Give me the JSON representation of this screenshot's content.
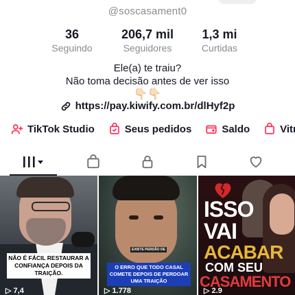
{
  "profile": {
    "handle": "@soscasament0",
    "stats": [
      {
        "value": "36",
        "label": "Seguindo"
      },
      {
        "value": "206,7 mil",
        "label": "Seguidores"
      },
      {
        "value": "1,3 mi",
        "label": "Curtidas"
      }
    ],
    "bio": {
      "line1": "Ele(a) te traiu?",
      "line2": "Não toma decisão antes de ver isso",
      "line3": "👇🏻👇🏻"
    },
    "link": "https://pay.kiwify.com.br/dlHyf2p"
  },
  "shortcuts": [
    {
      "label": "TikTok Studio",
      "icon": "person-plus-icon"
    },
    {
      "label": "Seus pedidos",
      "icon": "shopping-bag-check-icon"
    },
    {
      "label": "Saldo",
      "icon": "wallet-icon"
    },
    {
      "label": "Vitri",
      "icon": "shopping-bag-icon"
    }
  ],
  "tabs": [
    {
      "name": "videos",
      "icon": "grid-bars-icon",
      "active": true
    },
    {
      "name": "shop",
      "icon": "shopping-bag-icon"
    },
    {
      "name": "private",
      "icon": "lock-icon"
    },
    {
      "name": "saved",
      "icon": "bookmark-icon"
    },
    {
      "name": "liked",
      "icon": "heart-icon"
    }
  ],
  "videos": [
    {
      "caption": "NÃO É FÁCIL RESTAURAR A CONFIANÇA DEPOIS DA TRAIÇÃO.",
      "views": "▷ 7,4"
    },
    {
      "small_tag": "EXISTE PERDÃO DE",
      "caption": "O ERRO QUE TODO CASAL COMETE DEPOIS DE PERDOAR UMA TRAIÇÃO",
      "views": "▷ 1.778"
    },
    {
      "title_lines": [
        "ISSO",
        "VAI",
        "ACABAR",
        "COM SEU",
        "CASAMENTO"
      ],
      "views": "▷ 2.9"
    }
  ],
  "colors": {
    "text": "#161823",
    "muted": "#8a8b91",
    "accent": "#fe2c55",
    "cell3_title_gold": "#e7b73a",
    "cell3_title_red": "#e23b3b"
  }
}
